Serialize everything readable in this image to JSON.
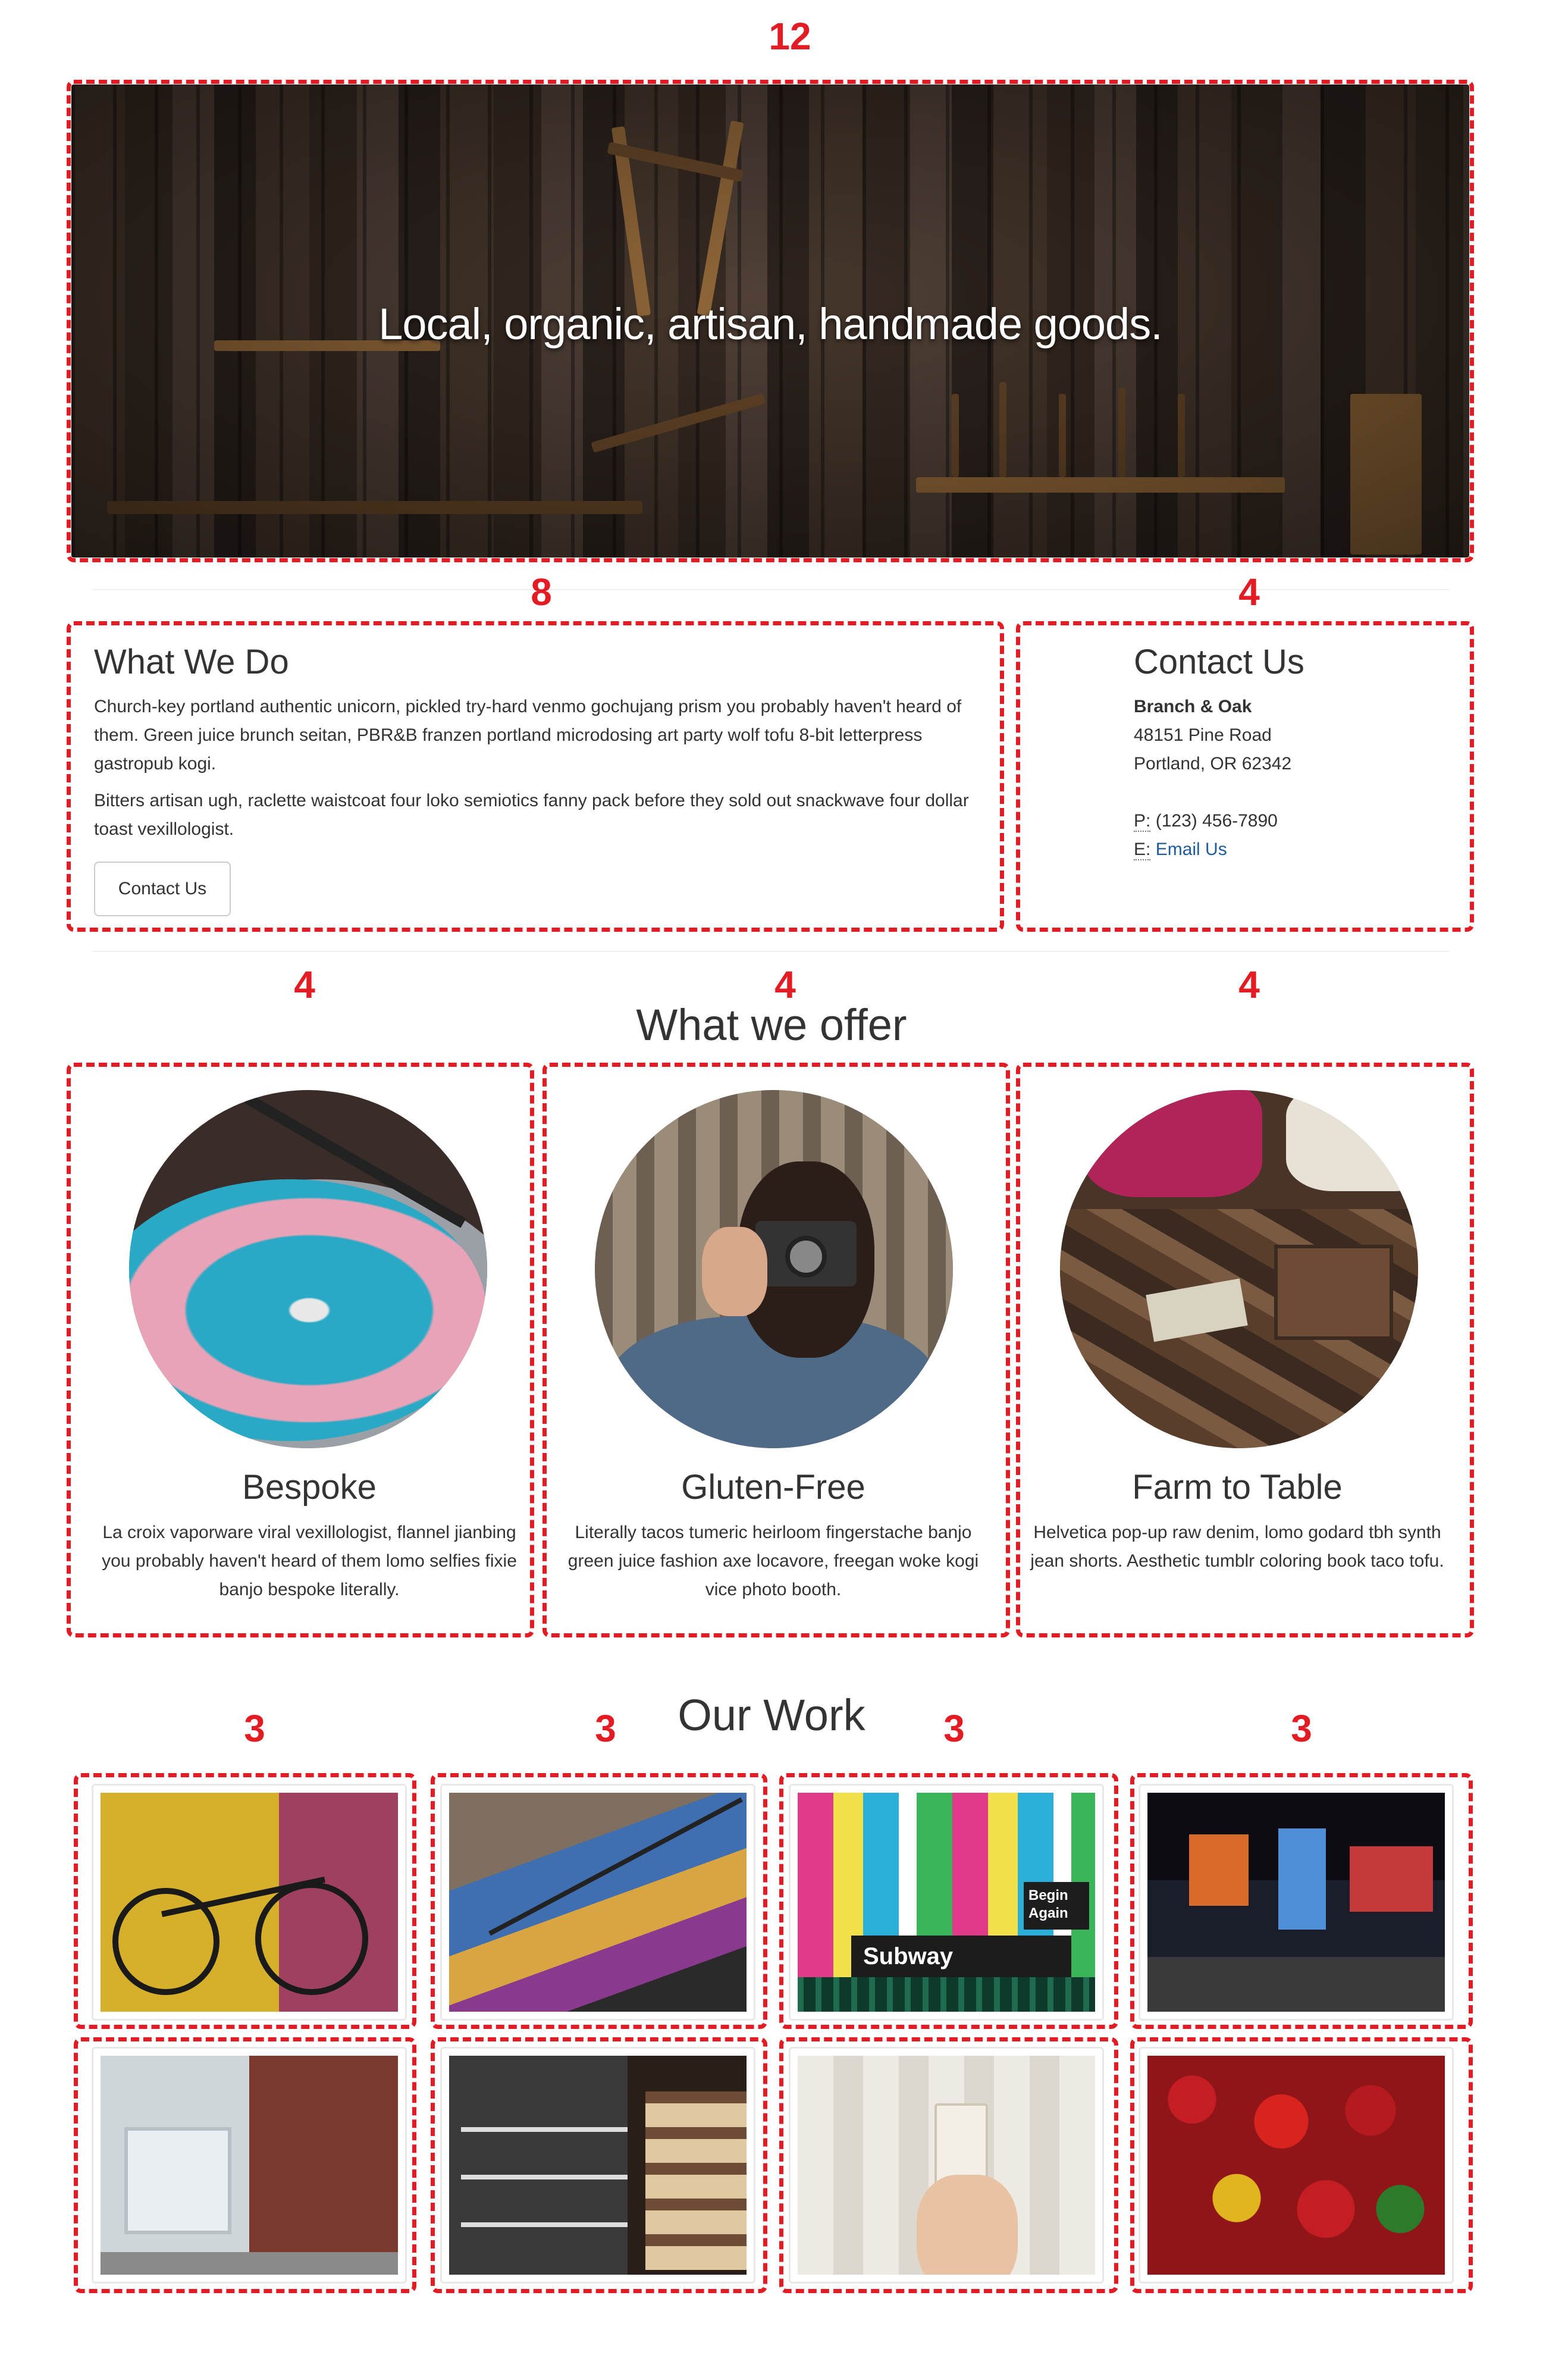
{
  "hero": {
    "col_span": "12",
    "title": "Local, organic, artisan, handmade goods."
  },
  "about": {
    "col_span": "8",
    "heading": "What We Do",
    "paragraphs": [
      "Church-key portland authentic unicorn, pickled try-hard venmo gochujang prism you probably haven't heard of them. Green juice brunch seitan, PBR&B franzen portland microdosing art party wolf tofu 8-bit letterpress gastropub kogi.",
      "Bitters artisan ugh, raclette waistcoat four loko semiotics fanny pack before they sold out snackwave four dollar toast vexillologist."
    ],
    "button_label": "Contact Us"
  },
  "contact": {
    "col_span": "4",
    "heading": "Contact Us",
    "company": "Branch & Oak",
    "address_line1": "48151 Pine Road",
    "address_line2": "Portland, OR 62342",
    "phone_label": "P:",
    "phone": "(123) 456-7890",
    "email_label": "E:",
    "email_link": "Email Us"
  },
  "offer": {
    "heading": "What we offer",
    "items": [
      {
        "col_span": "4",
        "title": "Bespoke",
        "text": "La croix vaporware viral vexillologist, flannel jianbing you probably haven't heard of them lomo selfies fixie banjo bespoke literally.",
        "image": "record-player-photo"
      },
      {
        "col_span": "4",
        "title": "Gluten-Free",
        "text": "Literally tacos tumeric heirloom fingerstache banjo green juice fashion axe locavore, freegan woke kogi vice photo booth.",
        "image": "man-with-camera-photo"
      },
      {
        "col_span": "4",
        "title": "Farm to Table",
        "text": "Helvetica pop-up raw denim, lomo godard tbh synth jean shorts. Aesthetic tumblr coloring book taco tofu.",
        "image": "leather-workshop-photo"
      }
    ]
  },
  "work": {
    "heading": "Our Work",
    "col_spans": [
      "3",
      "3",
      "3",
      "3"
    ],
    "subway_sign": "Subway",
    "begin_again": "Begin Again",
    "thumbnails": [
      "bicycle-graffiti-wall",
      "graffiti-staircase",
      "subway-entrance-posters",
      "city-street-night",
      "storefront-building",
      "shop-shelves-interior",
      "coffee-cup-hand",
      "red-peppers-market"
    ]
  },
  "colors": {
    "annotation": "#e31b23",
    "text": "#333333",
    "link": "#1f5c99",
    "divider": "#eeeeee"
  }
}
